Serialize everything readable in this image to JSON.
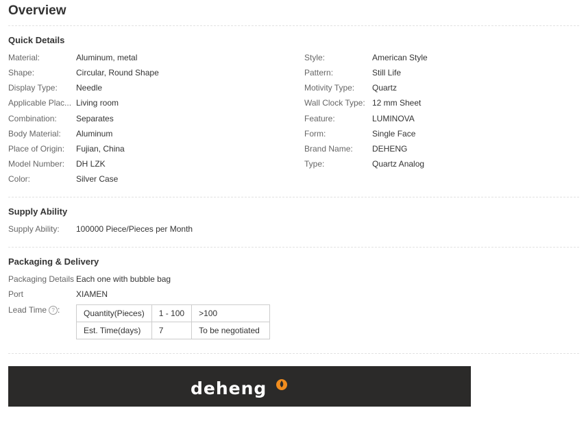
{
  "overview": {
    "title": "Overview"
  },
  "quick_details": {
    "title": "Quick Details",
    "left": [
      {
        "label": "Material:",
        "value": "Aluminum, metal"
      },
      {
        "label": "Shape:",
        "value": "Circular, Round Shape"
      },
      {
        "label": "Display Type:",
        "value": "Needle"
      },
      {
        "label": "Applicable Plac...",
        "value": "Living room"
      },
      {
        "label": "Combination:",
        "value": "Separates"
      },
      {
        "label": "Body Material:",
        "value": "Aluminum"
      },
      {
        "label": "Place of Origin:",
        "value": "Fujian, China"
      },
      {
        "label": "Model Number:",
        "value": "DH LZK"
      },
      {
        "label": "Color:",
        "value": "Silver Case"
      }
    ],
    "right": [
      {
        "label": "Style:",
        "value": "American Style"
      },
      {
        "label": "Pattern:",
        "value": "Still Life"
      },
      {
        "label": "Motivity Type:",
        "value": "Quartz"
      },
      {
        "label": "Wall Clock Type:",
        "value": "12 mm Sheet"
      },
      {
        "label": "Feature:",
        "value": "LUMINOVA"
      },
      {
        "label": "Form:",
        "value": "Single Face"
      },
      {
        "label": "Brand Name:",
        "value": "DEHENG"
      },
      {
        "label": "Type:",
        "value": "Quartz Analog"
      }
    ]
  },
  "supply": {
    "title": "Supply Ability",
    "label": "Supply Ability:",
    "value": "100000 Piece/Pieces per Month"
  },
  "packaging": {
    "title": "Packaging & Delivery",
    "details_label": "Packaging Details",
    "details_value": "Each one with bubble bag",
    "port_label": "Port",
    "port_value": "XIAMEN",
    "lead_time_label": "Lead Time",
    "lead_time_icon": "question-circle-icon",
    "table": [
      [
        "Quantity(Pieces)",
        "1 - 100",
        ">100"
      ],
      [
        "Est. Time(days)",
        "7",
        "To be negotiated"
      ]
    ]
  },
  "banner": {
    "brand": "deheng",
    "background": "#2b2a29",
    "accent": "#f08c1e"
  }
}
